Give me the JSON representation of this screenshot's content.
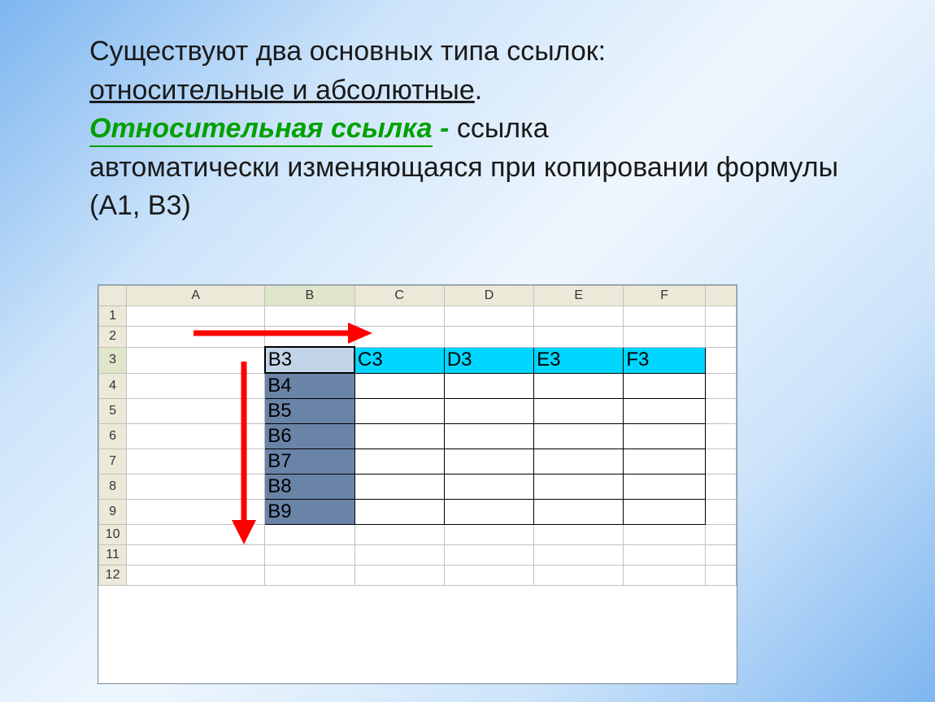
{
  "text": {
    "line1a": "Существуют два основных типа ссылок: ",
    "line1b": "относительные и абсолютные",
    "dot": ".",
    "green": "Относительная ссылка",
    "dash": "  -  ",
    "rest1": "ссылка",
    "rest2": "автоматически изменяющаяся при копировании формулы (А1, В3)"
  },
  "columns": [
    "A",
    "B",
    "C",
    "D",
    "E",
    "F"
  ],
  "rows": [
    "1",
    "2",
    "3",
    "4",
    "5",
    "6",
    "7",
    "8",
    "9",
    "10",
    "11",
    "12"
  ],
  "cells": {
    "B3": "B3",
    "C3": "C3",
    "D3": "D3",
    "E3": "E3",
    "F3": "F3",
    "B4": "B4",
    "B5": "B5",
    "B6": "B6",
    "B7": "B7",
    "B8": "B8",
    "B9": "B9"
  }
}
